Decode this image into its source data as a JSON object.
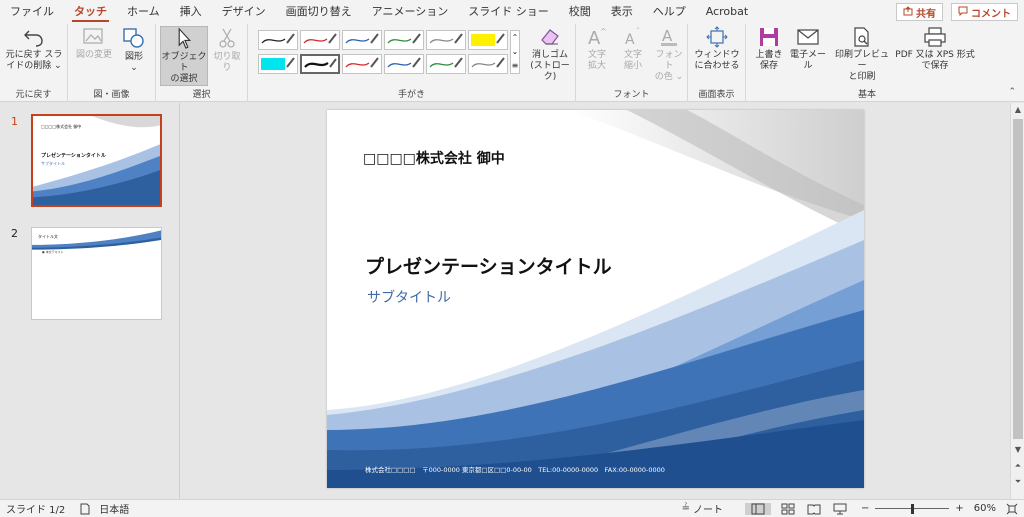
{
  "menu": {
    "items": [
      "ファイル",
      "タッチ",
      "ホーム",
      "挿入",
      "デザイン",
      "画面切り替え",
      "アニメーション",
      "スライド ショー",
      "校閲",
      "表示",
      "ヘルプ",
      "Acrobat"
    ],
    "active": "タッチ",
    "share_label": "共有",
    "comment_label": "コメント"
  },
  "ribbon": {
    "undo": {
      "line1": "元に戻す スラ",
      "line2": "イドの削除",
      "group": "元に戻す"
    },
    "image_change": {
      "label": "図の変更"
    },
    "shapes": {
      "label": "図形"
    },
    "figure_group": "図・画像",
    "select_object": {
      "line1": "オブジェクト",
      "line2": "の選択"
    },
    "cut": {
      "label": "切り取り"
    },
    "select_group": "選択",
    "handwriting_group": "手がき",
    "eraser": {
      "line1": "消しゴム",
      "line2": "(ストローク)"
    },
    "text_enlarge": {
      "line1": "文字",
      "line2": "拡大"
    },
    "text_shrink": {
      "line1": "文字",
      "line2": "縮小"
    },
    "font_color": {
      "line1": "フォント",
      "line2": "の色"
    },
    "font_group": "フォント",
    "fit_window": {
      "line1": "ウィンドウ",
      "line2": "に合わせる"
    },
    "display_group": "画面表示",
    "save": {
      "line1": "上書き",
      "line2": "保存"
    },
    "email": {
      "label": "電子メール"
    },
    "print_preview": {
      "line1": "印刷プレビュー",
      "line2": "と印刷"
    },
    "pdf_save": {
      "line1": "PDF 又は XPS 形式",
      "line2": "で保存"
    },
    "basic_group": "基本"
  },
  "thumbnails": [
    {
      "num": "1",
      "company": "□□□□株式会社 御中",
      "title": "プレゼンテーションタイトル",
      "subtitle": "サブタイトル"
    },
    {
      "num": "2",
      "title": "タイトル文",
      "bullet": "● 本文テキスト"
    }
  ],
  "slide": {
    "company": "□□□□株式会社 御中",
    "title": "プレゼンテーションタイトル",
    "subtitle": "サブタイトル",
    "footer": "株式会社□□□□　〒000-0000 東京都□区□□0-00-00　TEL:00-0000-0000　FAX:00-0000-0000"
  },
  "status": {
    "slide_info": "スライド 1/2",
    "language": "日本語",
    "notes": "ノート",
    "zoom": "60%",
    "zoom_fraction": 0.5
  },
  "colors": {
    "accent": "#b7472a",
    "slide_blue": "#2e5f9e",
    "subtitle": "#3f6ba6"
  }
}
